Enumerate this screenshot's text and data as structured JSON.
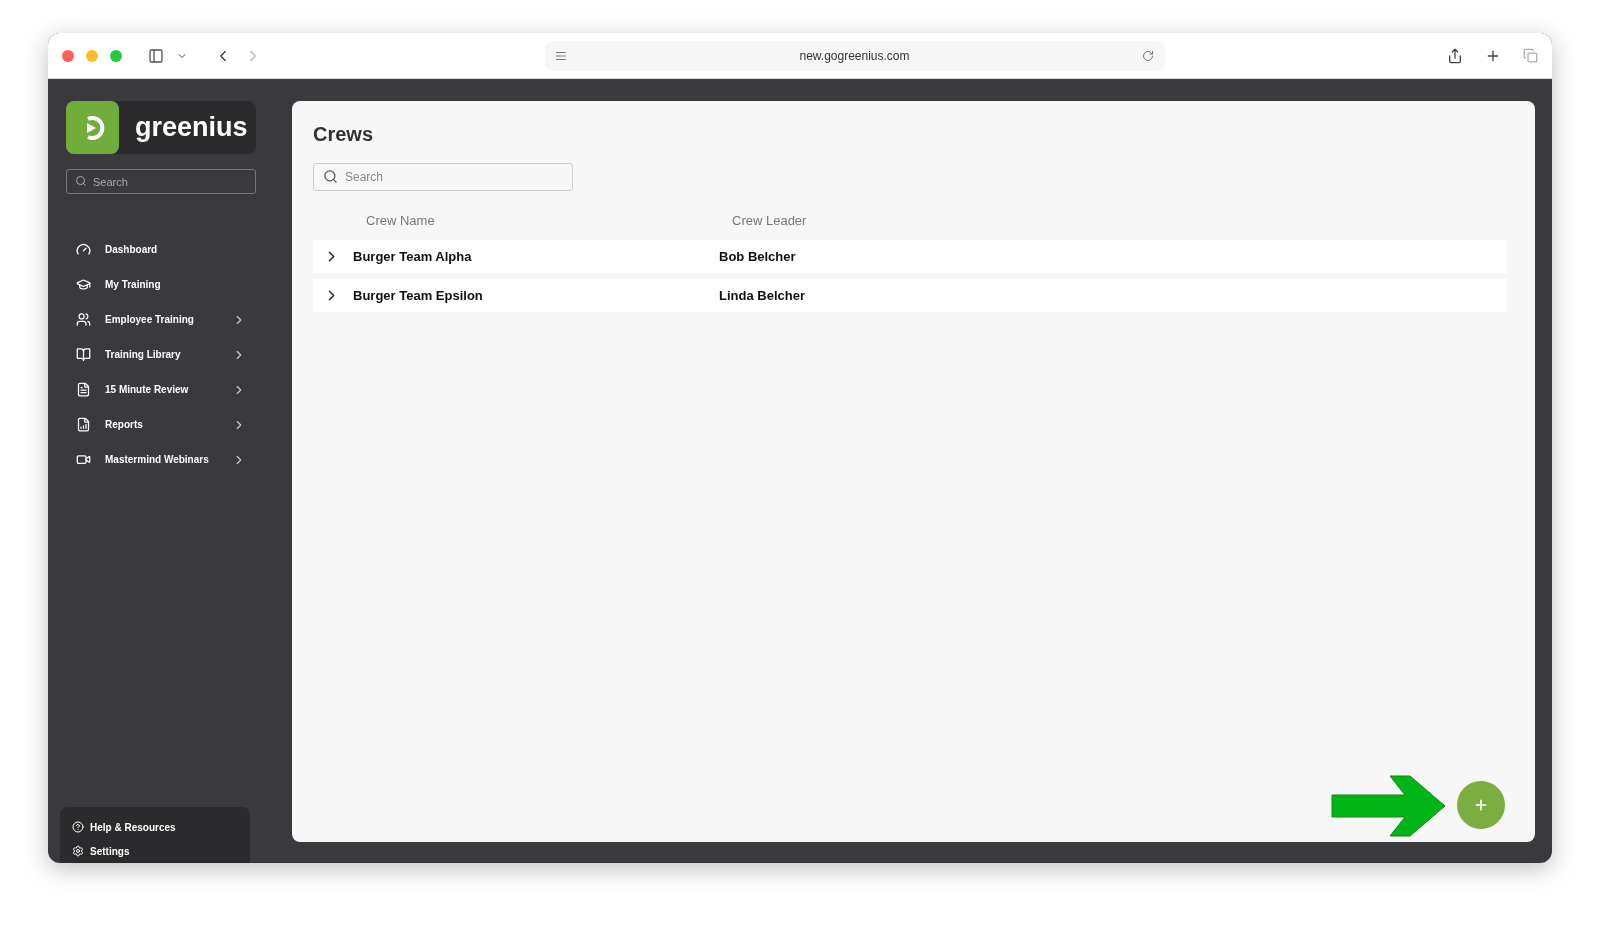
{
  "browser": {
    "url": "new.gogreenius.com"
  },
  "sidebar": {
    "logo": "greenius",
    "search": {
      "placeholder": "Search"
    },
    "items": [
      {
        "kind": "dashboard",
        "label": "Dashboard",
        "expandable": false
      },
      {
        "kind": "training",
        "label": "My Training",
        "expandable": false
      },
      {
        "kind": "employees",
        "label": "Employee Training",
        "expandable": true
      },
      {
        "kind": "library",
        "label": "Training Library",
        "expandable": true
      },
      {
        "kind": "review",
        "label": "15 Minute Review",
        "expandable": true
      },
      {
        "kind": "reports",
        "label": "Reports",
        "expandable": true
      },
      {
        "kind": "webinars",
        "label": "Mastermind Webinars",
        "expandable": true
      }
    ],
    "footer": [
      {
        "kind": "help",
        "label": "Help & Resources"
      },
      {
        "kind": "settings",
        "label": "Settings"
      }
    ]
  },
  "page": {
    "title": "Crews",
    "search": {
      "placeholder": "Search"
    },
    "table": {
      "columns": [
        "Crew Name",
        "Crew Leader"
      ],
      "rows": [
        {
          "cells": [
            "Burger Team Alpha",
            "Bob Belcher"
          ],
          "expanded": false
        },
        {
          "cells": [
            "Burger Team Epsilon",
            "Linda Belcher"
          ],
          "expanded": false
        }
      ]
    }
  }
}
